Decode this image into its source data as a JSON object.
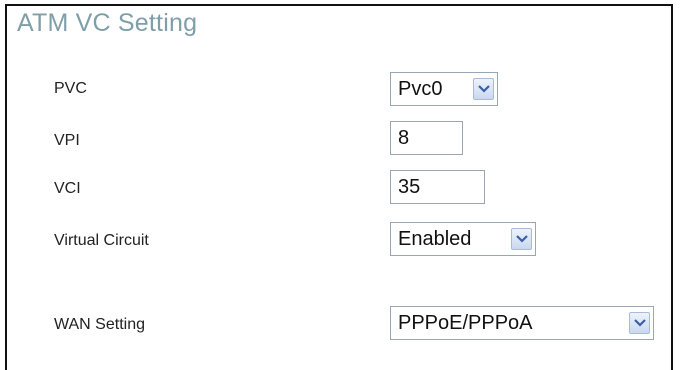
{
  "form": {
    "title": "ATM VC Setting",
    "pvc": {
      "label": "PVC",
      "value": "Pvc0"
    },
    "vpi": {
      "label": "VPI",
      "value": "8"
    },
    "vci": {
      "label": "VCI",
      "value": "35"
    },
    "virtual_circuit": {
      "label": "Virtual Circuit",
      "value": "Enabled"
    },
    "wan_setting": {
      "label": "WAN Setting",
      "value": "PPPoE/PPPoA"
    }
  },
  "icons": {
    "dropdown": "chevron-down-icon"
  },
  "colors": {
    "title": "#7f9fa8",
    "border": "#111111",
    "input_border": "#9aa7b3",
    "arrow_icon": "#3b5ea8"
  }
}
